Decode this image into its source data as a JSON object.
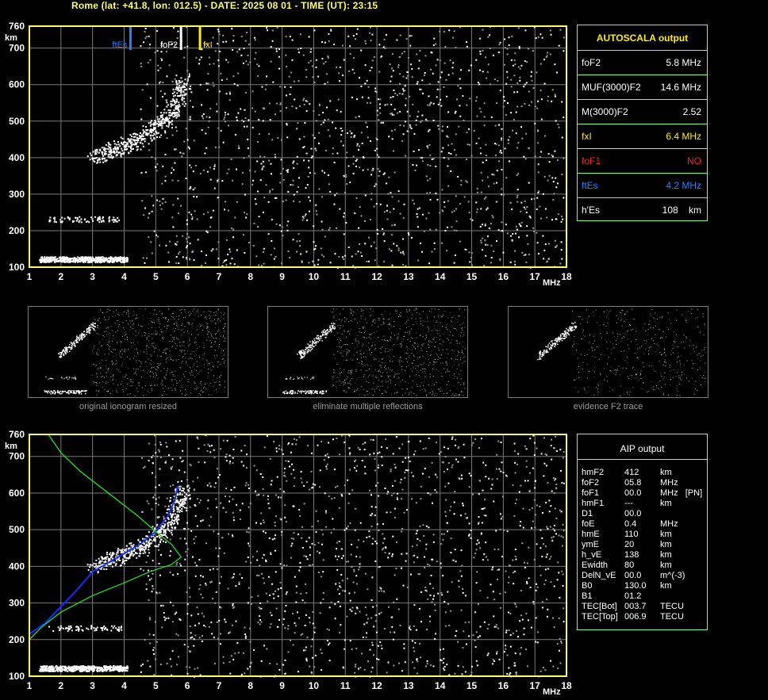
{
  "header": {
    "text": "Rome (lat: +41.8, lon: 012.5) - DATE: 2025 08 01 - TIME (UT): 23:15"
  },
  "colors": {
    "frame": "#ffff5a",
    "grid": "#7a7a7a",
    "panel_border": "#7fff7f",
    "ftEs": "#2a7fff",
    "foF2": "#ffffff",
    "fxI": "#ffee00",
    "foF1": "#ff2020",
    "profile": "#1030ff",
    "model": "#20e020"
  },
  "autoscala": {
    "title": "AUTOSCALA output",
    "rows": [
      {
        "label": "foF2",
        "value": "5.8 MHz",
        "color": "#ffffff"
      },
      {
        "label": "MUF(3000)F2",
        "value": "14.6 MHz",
        "color": "#ffffff"
      },
      {
        "label": "M(3000)F2",
        "value": "2.52",
        "color": "#ffffff"
      },
      {
        "label": "fxI",
        "value": "6.4 MHz",
        "color": "#ffee00"
      },
      {
        "label": "foF1",
        "value": "NO",
        "color": "#ff2020"
      },
      {
        "label": "ftEs",
        "value": "4.2 MHz",
        "color": "#2a7fff"
      },
      {
        "label": "h'Es",
        "value": "108    km",
        "color": "#ffffff"
      }
    ]
  },
  "aip": {
    "title": "AIP output",
    "rows": [
      {
        "name": "hmF2",
        "value": "412",
        "unit": "km"
      },
      {
        "name": "foF2",
        "value": "05.8",
        "unit": "MHz"
      },
      {
        "name": "foF1",
        "value": "00.0",
        "unit": "MHz   [PN]"
      },
      {
        "name": "hmF1",
        "value": "---",
        "unit": "km"
      },
      {
        "name": "D1",
        "value": "00.0",
        "unit": ""
      },
      {
        "name": "foE",
        "value": "0.4",
        "unit": "MHz"
      },
      {
        "name": "hmE",
        "value": "110",
        "unit": "km"
      },
      {
        "name": "ymE",
        "value": "20",
        "unit": "km"
      },
      {
        "name": "h_vE",
        "value": "138",
        "unit": "km"
      },
      {
        "name": "Ewidth",
        "value": "80",
        "unit": "km"
      },
      {
        "name": "DelN_vE",
        "value": "00.0",
        "unit": "m^(-3)"
      },
      {
        "name": "B0",
        "value": "130.0",
        "unit": "km"
      },
      {
        "name": "B1",
        "value": "01.2",
        "unit": ""
      },
      {
        "name": "TEC[Bot]",
        "value": "003.7",
        "unit": "TECU"
      },
      {
        "name": "TEC[Top]",
        "value": "006.9",
        "unit": "TECU"
      }
    ]
  },
  "thumbnails": [
    {
      "caption": "original ionogram resized"
    },
    {
      "caption": "eliminate multiple reflections"
    },
    {
      "caption": "evidence F2 trace"
    }
  ],
  "chart_data": [
    {
      "type": "scatter",
      "title": "",
      "xlabel": "MHz",
      "ylabel": "km",
      "xlim": [
        1,
        18
      ],
      "ylim": [
        100,
        760
      ],
      "x_ticks": [
        1,
        2,
        3,
        4,
        5,
        6,
        7,
        8,
        9,
        10,
        11,
        12,
        13,
        14,
        15,
        16,
        17,
        18
      ],
      "y_ticks": [
        100,
        200,
        300,
        400,
        500,
        600,
        700,
        760
      ],
      "grid": true,
      "markers": [
        {
          "name": "ftEs",
          "x": 4.2
        },
        {
          "name": "foF2",
          "x": 5.8
        },
        {
          "name": "fxI",
          "x": 6.4
        }
      ],
      "traces": [
        {
          "name": "Es",
          "x_range": [
            1.3,
            4.1
          ],
          "h_range": [
            115,
            130
          ]
        },
        {
          "name": "Es-multiple",
          "x_range": [
            1.6,
            3.9
          ],
          "h_range": [
            225,
            240
          ]
        },
        {
          "name": "F2",
          "points": [
            [
              3.0,
              395
            ],
            [
              3.5,
              410
            ],
            [
              4.0,
              425
            ],
            [
              4.5,
              445
            ],
            [
              5.0,
              475
            ],
            [
              5.4,
              510
            ],
            [
              5.7,
              560
            ],
            [
              5.9,
              610
            ]
          ]
        }
      ]
    },
    {
      "type": "line",
      "title": "",
      "xlabel": "MHz",
      "ylabel": "km",
      "xlim": [
        1,
        18
      ],
      "ylim": [
        100,
        760
      ],
      "x_ticks": [
        1,
        2,
        3,
        4,
        5,
        6,
        7,
        8,
        9,
        10,
        11,
        12,
        13,
        14,
        15,
        16,
        17,
        18
      ],
      "y_ticks": [
        100,
        200,
        300,
        400,
        500,
        600,
        700,
        760
      ],
      "grid": true,
      "series": [
        {
          "name": "",
          "points": [
            [
              1.0,
              215
            ],
            [
              1.5,
              245
            ],
            [
              2.0,
              290
            ],
            [
              2.5,
              335
            ],
            [
              3.0,
              385
            ],
            [
              3.5,
              410
            ],
            [
              4.0,
              435
            ],
            [
              4.5,
              460
            ],
            [
              5.0,
              495
            ],
            [
              5.4,
              540
            ],
            [
              5.6,
              580
            ],
            [
              5.7,
              620
            ]
          ]
        },
        {
          "name": "",
          "points": [
            [
              1.6,
              760
            ],
            [
              2.0,
              710
            ],
            [
              2.6,
              660
            ],
            [
              3.2,
              620
            ],
            [
              3.8,
              580
            ],
            [
              4.4,
              540
            ],
            [
              5.0,
              495
            ],
            [
              5.5,
              460
            ],
            [
              5.8,
              425
            ],
            [
              5.5,
              405
            ],
            [
              4.8,
              385
            ],
            [
              4.0,
              355
            ],
            [
              3.0,
              320
            ],
            [
              2.0,
              275
            ],
            [
              1.4,
              235
            ],
            [
              1.0,
              200
            ]
          ]
        }
      ]
    }
  ]
}
